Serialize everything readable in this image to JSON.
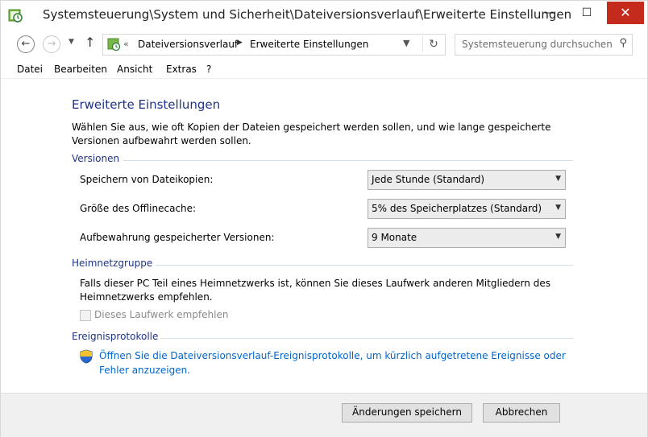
{
  "window": {
    "title": "Systemsteuerung\\System und Sicherheit\\Dateiversionsverlauf\\Erweiterte Einstellungen",
    "controls": {
      "minimize": "—",
      "maximize": "☐",
      "close": "✕"
    }
  },
  "address_bar": {
    "overflow": "«",
    "crumbs": [
      "Dateiversionsverlauf",
      "Erweiterte Einstellungen"
    ],
    "separator": "▶"
  },
  "search": {
    "placeholder": "Systemsteuerung durchsuchen"
  },
  "menu": {
    "items": [
      "Datei",
      "Bearbeiten",
      "Ansicht",
      "Extras",
      "?"
    ]
  },
  "page": {
    "title": "Erweiterte Einstellungen",
    "intro": "Wählen Sie aus, wie oft Kopien der Dateien gespeichert werden sollen, und wie lange gespeicherte Versionen aufbewahrt werden sollen."
  },
  "versions": {
    "heading": "Versionen",
    "settings": [
      {
        "label": "Speichern von Dateikopien:",
        "value": "Jede Stunde (Standard)"
      },
      {
        "label": "Größe des Offlinecache:",
        "value": "5% des Speicherplatzes (Standard)"
      },
      {
        "label": "Aufbewahrung gespeicherter Versionen:",
        "value": "9 Monate"
      }
    ]
  },
  "homegroup": {
    "heading": "Heimnetzgruppe",
    "text": "Falls dieser PC Teil eines Heimnetzwerks ist, können Sie dieses Laufwerk anderen Mitgliedern des Heimnetzwerks empfehlen.",
    "checkbox_label": "Dieses Laufwerk empfehlen",
    "checkbox_checked": false
  },
  "eventlogs": {
    "heading": "Ereignisprotokolle",
    "link": "Öffnen Sie die Dateiversionsverlauf-Ereignisprotokolle, um kürzlich aufgetretene Ereignisse oder Fehler anzuzeigen."
  },
  "footer": {
    "save": "Änderungen speichern",
    "cancel": "Abbrechen"
  },
  "icons": {
    "app": "file-history-icon",
    "back": "back-arrow-icon",
    "forward": "forward-arrow-icon",
    "up": "up-arrow-icon",
    "refresh": "refresh-icon",
    "search": "search-icon",
    "shield": "uac-shield-icon"
  },
  "colors": {
    "heading_blue": "#1e3287",
    "link_blue": "#0066cc",
    "close_red": "#c42b1c"
  }
}
